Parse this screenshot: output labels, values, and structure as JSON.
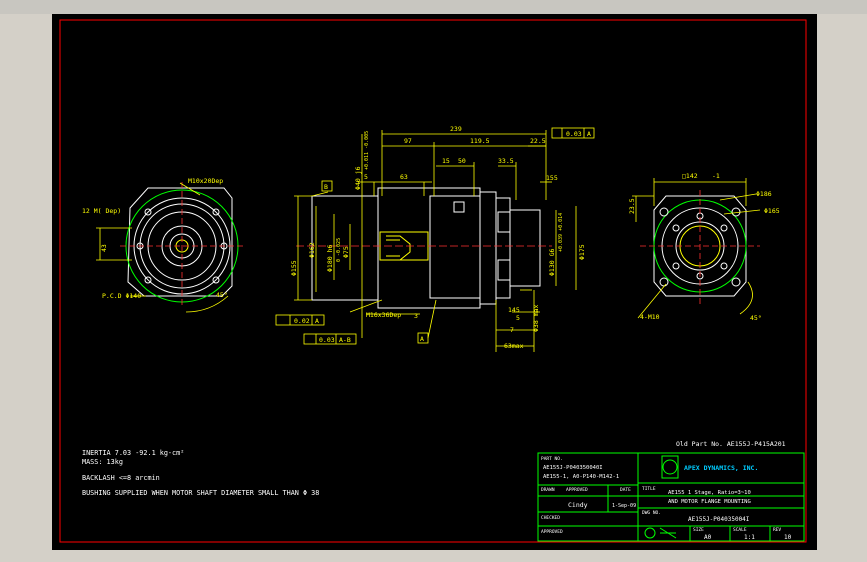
{
  "dimensions": {
    "top_overall": "239",
    "top_97": "97",
    "top_119_5": "119.5",
    "top_22_5": "22.5",
    "top_15": "15",
    "top_50": "50",
    "top_33_5": "33.5",
    "top_5": "5",
    "top_63": "63",
    "top_155": "155",
    "shaft_fit": "Φ40 j6",
    "shaft_fit_tol": "+0.011 -0.005",
    "bore_fit": "Φ180 h6",
    "bore_fit_tol": "0 -0.025",
    "left_162": "Φ162",
    "left_155": "Φ155",
    "left_75": "Φ75",
    "center_130": "Φ130 G6",
    "center_130_tol": "+0.039 +0.014",
    "center_175": "Φ175",
    "tap_note": "M16x36Dep",
    "right_3": "3",
    "right_145": "145",
    "right_5": "5",
    "right_38max": "Φ38 max",
    "right_7": "7",
    "right_63max": "63max",
    "flange_142": "□142",
    "flange_tol": "-1",
    "right_23_5": "23.5",
    "pcd_186": "Φ186",
    "pcd_165": "Φ165",
    "holes_4m10": "4-M10",
    "angle_45_right": "45°",
    "holes_m10_dep": "M10x20Dep",
    "thread_12m": "12 M( Dep)",
    "dim_43": "43",
    "pcd_140": "P.C.D Φ140",
    "angle_45_left": "45°",
    "datum_b": "B",
    "datum_a": "A",
    "gdt_top": "0.03",
    "gdt_top_ref": "A",
    "gdt_flat": "0.02",
    "gdt_flat_ref": "A",
    "gdt_conc": "0.03",
    "gdt_conc_ref": "A-B"
  },
  "notes": {
    "inertia": "INERTIA   7.03 -92.1 kg-cm²",
    "mass": "MASS: 13kg",
    "backlash": "BACKLASH <=8 arcmin",
    "bushing": "BUSHING SUPPLIED WHEN MOTOR SHAFT DIAMETER SMALL THAN Φ 38"
  },
  "title_block": {
    "ref_part": "Old Part No. AE155J-P415A201",
    "part_no_label": "PART NO.",
    "part_no_1": "AE155J-P040350040I",
    "part_no_2": "AE155-1, A0-P140-M142-1",
    "drawn_label": "DRAWN",
    "approved_label": "APPROVED",
    "date_label": "DATE",
    "drawn_by": "Cindy",
    "date": "1-Sep-09",
    "checked_label": "CHECKED",
    "approved2_label": "APPROVED",
    "company": "APEX DYNAMICS, INC.",
    "title_label": "TITLE",
    "title_1": "AE155 1 Stage, Ratio=3~10",
    "title_2": "AND MOTOR FLANGE MOUNTING",
    "dwg_label": "DWG NO.",
    "dwg_no": "AE155J-P04035004I",
    "size_label": "SIZE",
    "size": "A0",
    "scale_label": "SCALE",
    "scale": "1:1",
    "rev_label": "REV",
    "rev": "10"
  },
  "colors": {
    "background": "#000000",
    "outline": "#ffffff",
    "dimension": "#ffff00",
    "frame": "#ff0000",
    "title_block": "#00ff00",
    "centerline": "#ff3030"
  }
}
